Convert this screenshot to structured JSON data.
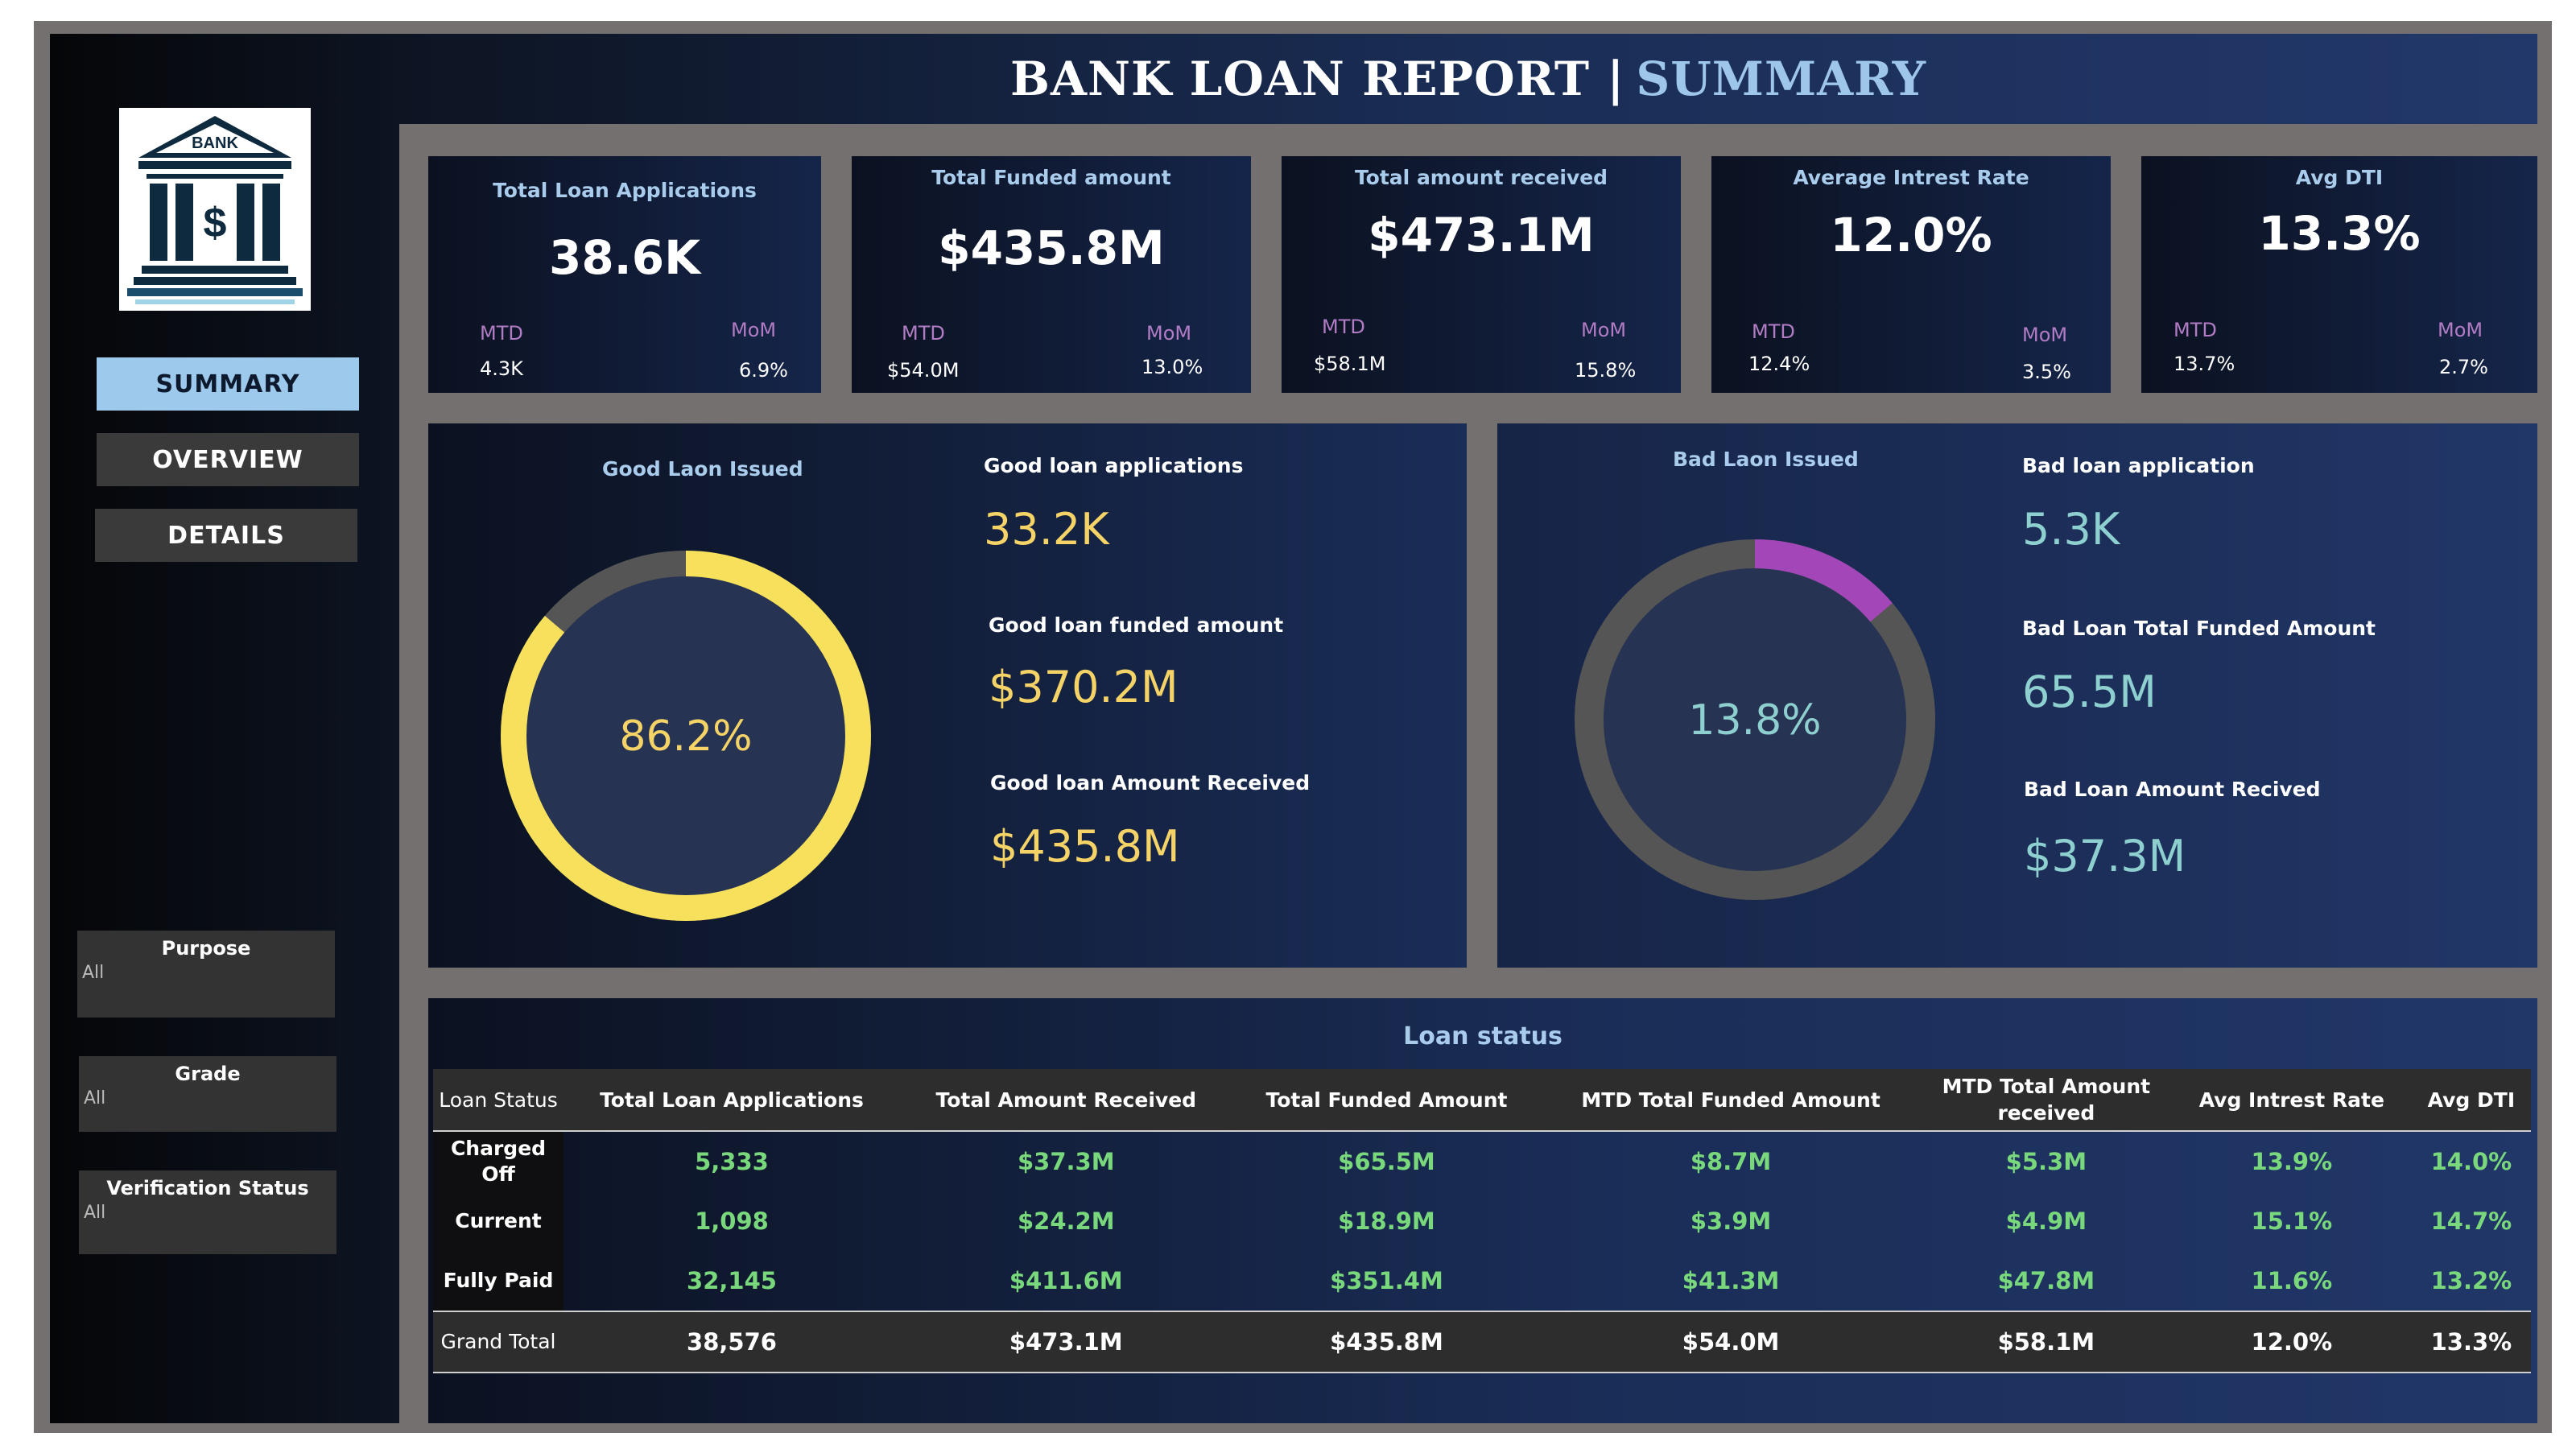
{
  "header": {
    "title_main": "BANK LOAN REPORT |",
    "title_accent": "SUMMARY"
  },
  "logo": {
    "text": "BANK",
    "symbol": "$"
  },
  "nav": {
    "summary": "SUMMARY",
    "overview": "OVERVIEW",
    "details": "DETAILS"
  },
  "filters": {
    "purpose": {
      "label": "Purpose",
      "value": "All"
    },
    "grade": {
      "label": "Grade",
      "value": "All"
    },
    "verification": {
      "label": "Verification Status",
      "value": "All"
    }
  },
  "kpis": [
    {
      "title": "Total Loan Applications",
      "value": "38.6K",
      "mtd_label": "MTD",
      "mtd": "4.3K",
      "mom_label": "MoM",
      "mom": "6.9%"
    },
    {
      "title": "Total Funded amount",
      "value": "$435.8M",
      "mtd_label": "MTD",
      "mtd": "$54.0M",
      "mom_label": "MoM",
      "mom": "13.0%"
    },
    {
      "title": "Total amount received",
      "value": "$473.1M",
      "mtd_label": "MTD",
      "mtd": "$58.1M",
      "mom_label": "MoM",
      "mom": "15.8%"
    },
    {
      "title": "Average Intrest Rate",
      "value": "12.0%",
      "mtd_label": "MTD",
      "mtd": "12.4%",
      "mom_label": "MoM",
      "mom": "3.5%"
    },
    {
      "title": "Avg DTI",
      "value": "13.3%",
      "mtd_label": "MTD",
      "mtd": "13.7%",
      "mom_label": "MoM",
      "mom": "2.7%"
    }
  ],
  "good": {
    "title": "Good Laon Issued",
    "percent_label": "86.2%",
    "percent": 86.2,
    "apps_label": "Good loan applications",
    "apps": "33.2K",
    "funded_label": "Good loan funded amount",
    "funded": "$370.2M",
    "received_label": "Good loan Amount Received",
    "received": "$435.8M"
  },
  "bad": {
    "title": "Bad Laon Issued",
    "percent_label": "13.8%",
    "percent": 13.8,
    "apps_label": "Bad loan application",
    "apps": "5.3K",
    "funded_label": "Bad Loan Total Funded Amount",
    "funded": "65.5M",
    "received_label": "Bad Loan Amount Recived",
    "received": "$37.3M"
  },
  "colors": {
    "good_ring": "#f7e15c",
    "bad_ring": "#a347b8",
    "ring_track": "#555555",
    "ring_inner": "#263352"
  },
  "loan_status": {
    "title": "Loan status",
    "headers": [
      "Loan Status",
      "Total Loan Applications",
      "Total Amount Received",
      "Total Funded Amount",
      "MTD Total Funded Amount",
      "MTD Total Amount received",
      "Avg Intrest Rate",
      "Avg DTI"
    ],
    "rows": [
      [
        "Charged Off",
        "5,333",
        "$37.3M",
        "$65.5M",
        "$8.7M",
        "$5.3M",
        "13.9%",
        "14.0%"
      ],
      [
        "Current",
        "1,098",
        "$24.2M",
        "$18.9M",
        "$3.9M",
        "$4.9M",
        "15.1%",
        "14.7%"
      ],
      [
        "Fully Paid",
        "32,145",
        "$411.6M",
        "$351.4M",
        "$41.3M",
        "$47.8M",
        "11.6%",
        "13.2%"
      ]
    ],
    "total": [
      "Grand Total",
      "38,576",
      "$473.1M",
      "$435.8M",
      "$54.0M",
      "$58.1M",
      "12.0%",
      "13.3%"
    ]
  }
}
